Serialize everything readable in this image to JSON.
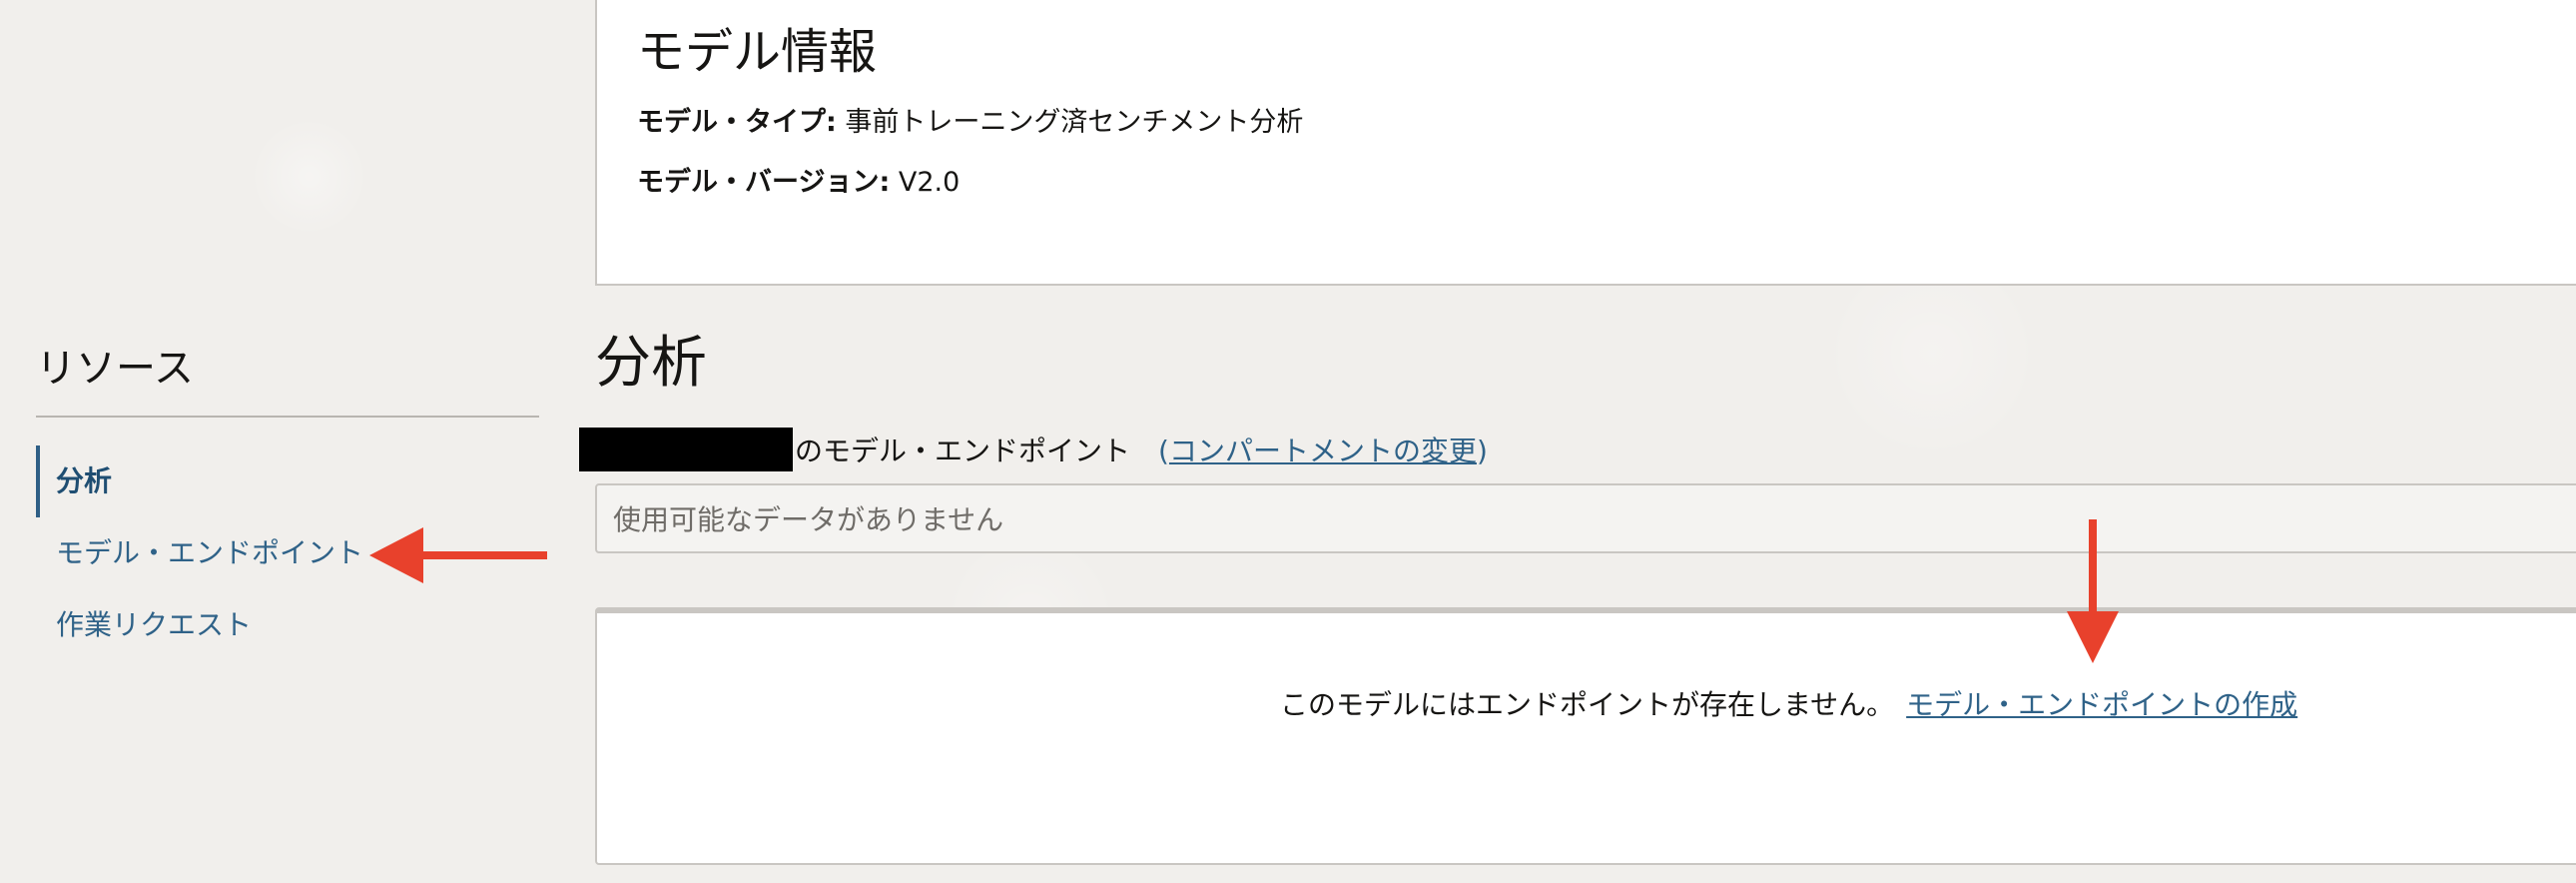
{
  "model_info": {
    "title": "モデル情報",
    "type_label": "モデル・タイプ:",
    "type_value": "事前トレーニング済センチメント分析",
    "version_label": "モデル・バージョン:",
    "version_value": "V2.0"
  },
  "sidebar": {
    "title": "リソース",
    "items": [
      {
        "label": "分析",
        "active": true
      },
      {
        "label": "モデル・エンドポイント",
        "active": false
      },
      {
        "label": "作業リクエスト",
        "active": false
      }
    ]
  },
  "analysis": {
    "title": "分析",
    "compartment_suffix": "のモデル・エンドポイント",
    "compartment_link_open": "(",
    "compartment_link": "コンパートメントの変更",
    "compartment_link_close": ")",
    "data_placeholder": "使用可能なデータがありません",
    "empty_message": "このモデルにはエンドポイントが存在しません。",
    "create_endpoint_link": "モデル・エンドポイントの作成"
  },
  "colors": {
    "link": "#2f6288",
    "annotation_arrow": "#e8412c",
    "background": "#f1efec",
    "panel": "#ffffff"
  }
}
